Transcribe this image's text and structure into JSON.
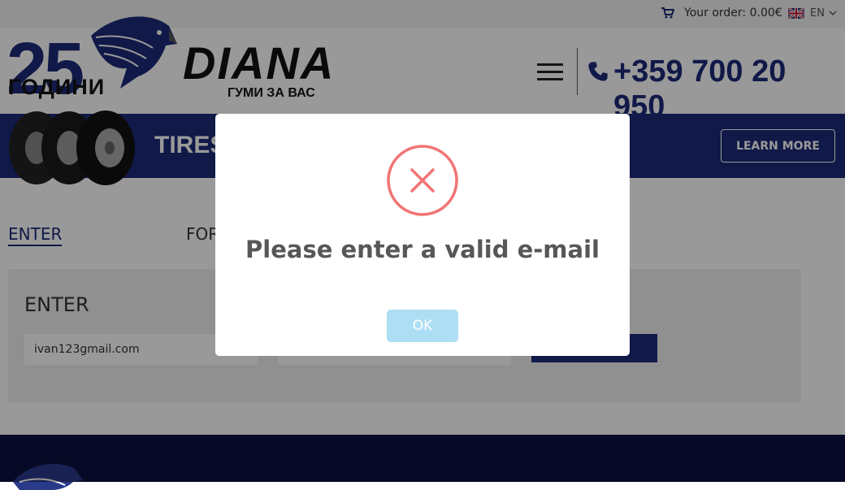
{
  "topbar": {
    "order_label": "Your order: 0.00€",
    "language": "EN",
    "icons": [
      "shopping-cart-icon",
      "uk-flag-icon",
      "chevron-down-icon"
    ]
  },
  "header": {
    "logo_number": "25",
    "logo_years": "ГОДИНИ",
    "logo_name": "DIANA",
    "logo_tagline": "ГУМИ ЗА ВАС",
    "phone": "+359 700 20 950",
    "icons": [
      "menu-icon",
      "phone-icon"
    ]
  },
  "banner": {
    "title": "TIRES",
    "cta_label": "LEARN MORE"
  },
  "tabs": {
    "enter": "ENTER",
    "forgot": "FOR"
  },
  "login": {
    "title": "ENTER",
    "email_value": "ivan123gmail.com",
    "password_value": ""
  },
  "modal": {
    "title": "Please enter a valid e-mail",
    "ok_label": "OK",
    "icon": "error-x-icon"
  },
  "colors": {
    "brand_blue": "#1c2a78",
    "footer_navy": "#0d1240",
    "error_red": "#f27474",
    "ok_button": "#aedef4"
  }
}
